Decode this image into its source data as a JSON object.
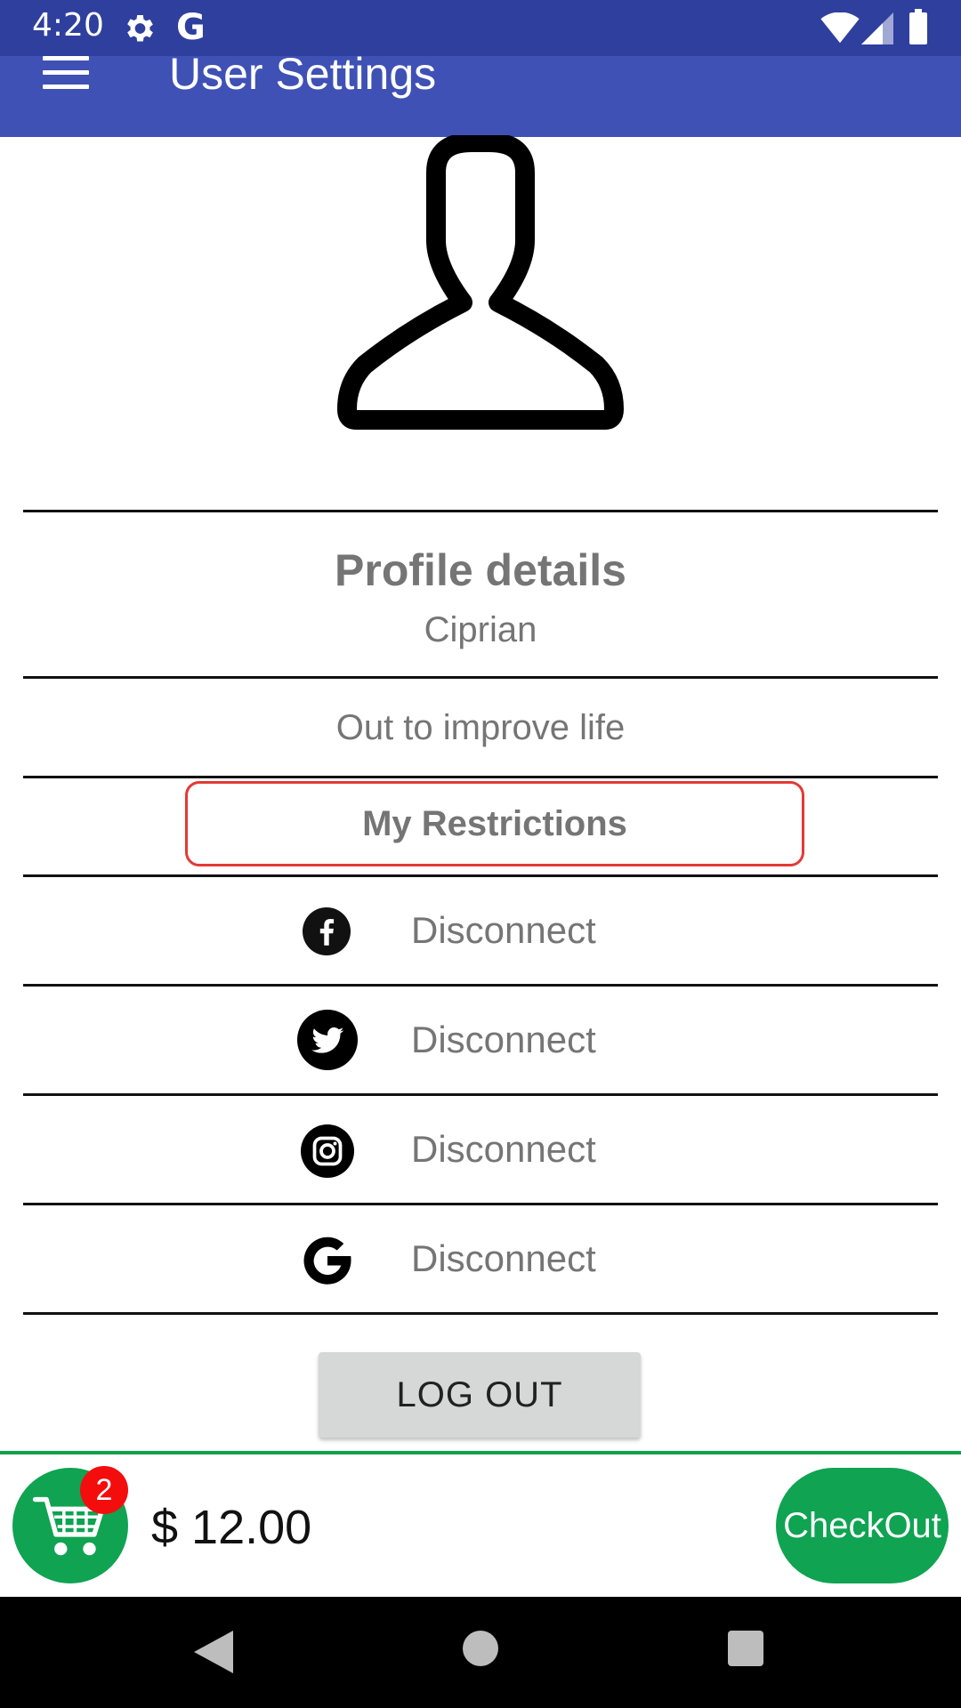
{
  "status_bar": {
    "time": "4:20",
    "g_label": "G",
    "icons": [
      "gear-icon",
      "wifi-icon",
      "signal-icon",
      "battery-icon"
    ]
  },
  "app_bar": {
    "title": "User Settings",
    "menu_icon": "hamburger-menu-icon",
    "background": "#3f51b5"
  },
  "profile": {
    "heading": "Profile details",
    "name": "Ciprian",
    "bio": "Out to improve life"
  },
  "restrictions": {
    "label": "My Restrictions",
    "border_color": "#e53935"
  },
  "social_accounts": [
    {
      "icon": "facebook-icon",
      "label": "Disconnect"
    },
    {
      "icon": "twitter-icon",
      "label": "Disconnect"
    },
    {
      "icon": "instagram-icon",
      "label": "Disconnect"
    },
    {
      "icon": "google-icon",
      "label": "Disconnect"
    }
  ],
  "logout": {
    "label": "LOG OUT"
  },
  "cart": {
    "badge_count": "2",
    "total": "$ 12.00",
    "checkout_label": "CheckOut",
    "accent": "#0fa352",
    "badge_color": "#f40d0d"
  },
  "nav": {
    "icons": [
      "back-icon",
      "home-icon",
      "recents-icon"
    ]
  }
}
